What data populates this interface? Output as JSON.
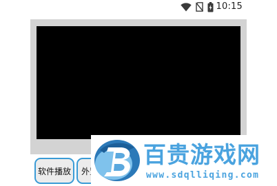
{
  "status_bar": {
    "time": "10:15",
    "icons": [
      "wifi-icon",
      "no-sim-icon",
      "battery-charging-icon"
    ]
  },
  "player": {
    "state": "black-video-surface"
  },
  "buttons": {
    "software_play": "软件播放",
    "external_play": "外置"
  },
  "watermark": {
    "title": "百贵游戏网",
    "url": "www.sdqlliqing.com",
    "logo": "b-logo-icon"
  },
  "colors": {
    "accent": "#3a9bd6",
    "watermark": "#4aa3df",
    "frame": "#d3d3d3",
    "video": "#000000"
  }
}
